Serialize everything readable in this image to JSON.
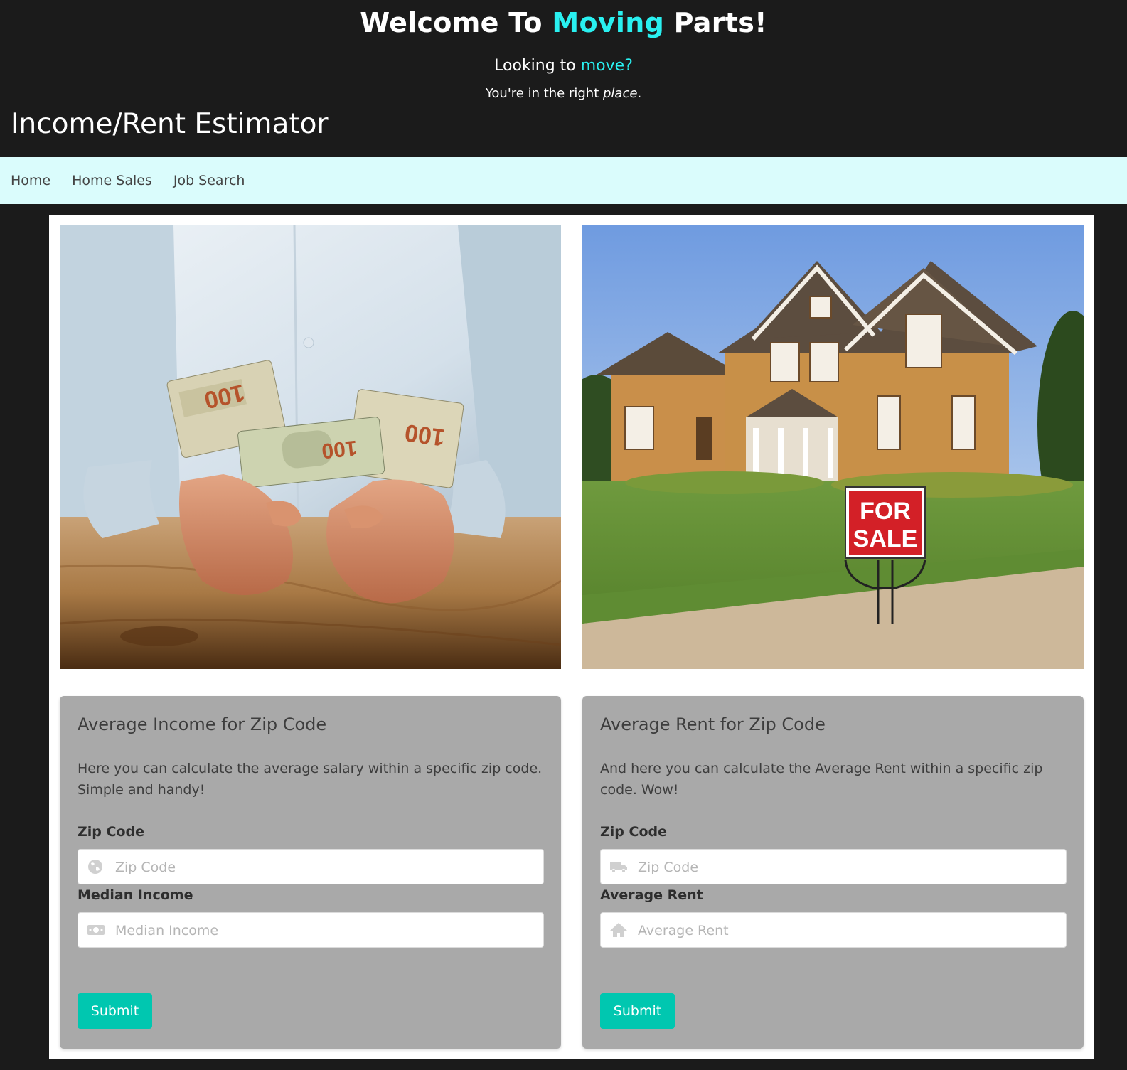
{
  "hero": {
    "title_part1": "Welcome To ",
    "title_accent": "Moving",
    "title_part2": " Parts!",
    "subtitle_part1": "Looking to ",
    "subtitle_accent": "move?",
    "tagline_part1": "You're in the right ",
    "tagline_italic": "place",
    "tagline_end": "."
  },
  "page_title": "Income/Rent Estimator",
  "nav": {
    "items": [
      {
        "label": "Home"
      },
      {
        "label": "Home Sales"
      },
      {
        "label": "Job Search"
      }
    ]
  },
  "sign": {
    "line1": "FOR",
    "line2": "SALE"
  },
  "income_card": {
    "title": "Average Income for Zip Code",
    "text": "Here you can calculate the average salary within a specific zip code. Simple and handy!",
    "zip_label": "Zip Code",
    "zip_placeholder": "Zip Code",
    "zip_icon": "globe-icon",
    "income_label": "Median Income",
    "income_placeholder": "Median Income",
    "income_icon": "money-icon",
    "submit_label": "Submit"
  },
  "rent_card": {
    "title": "Average Rent for Zip Code",
    "text": "And here you can calculate the Average Rent within a specific zip code. Wow!",
    "zip_label": "Zip Code",
    "zip_placeholder": "Zip Code",
    "zip_icon": "truck-icon",
    "rent_label": "Average Rent",
    "rent_placeholder": "Average Rent",
    "rent_icon": "home-icon",
    "submit_label": "Submit"
  },
  "colors": {
    "background": "#1b1b1b",
    "accent": "#29f0f0",
    "navbar": "#dafcfc",
    "card": "#a9a9a9",
    "button": "#00c7b0"
  }
}
